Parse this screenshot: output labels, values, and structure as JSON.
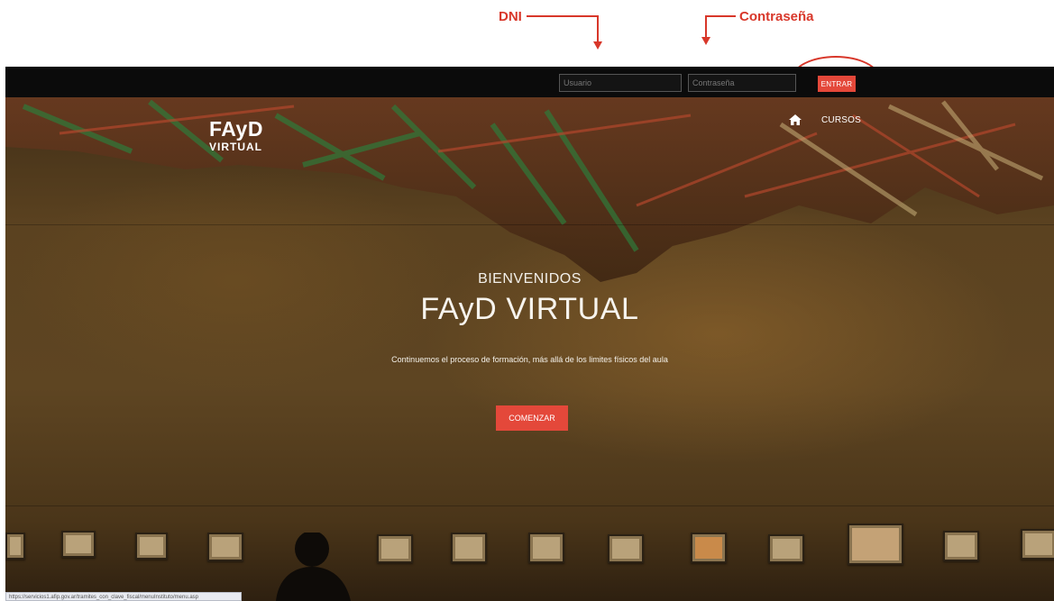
{
  "annotations": {
    "dni_label": "DNI",
    "password_label": "Contraseña",
    "highlight_color": "#d8372a"
  },
  "topbar": {
    "user_placeholder": "Usuario",
    "password_placeholder": "Contraseña",
    "enter_label": "ENTRAR"
  },
  "header": {
    "logo_main": "FAyD",
    "logo_sub": "VIRTUAL",
    "nav": {
      "home_icon": "home-icon",
      "courses_label": "CURSOS"
    }
  },
  "hero": {
    "welcome": "BIENVENIDOS",
    "title": "FAyD VIRTUAL",
    "description": "Continuemos el proceso de formación, más allá de los limites físicos del aula",
    "start_label": "COMENZAR"
  },
  "status_bar": {
    "url": "https://servicios1.afip.gov.ar/tramites_con_clave_fiscal/menuInstituto/menu.asp"
  },
  "colors": {
    "accent": "#e4483a",
    "topbar": "#0b0b0b"
  }
}
